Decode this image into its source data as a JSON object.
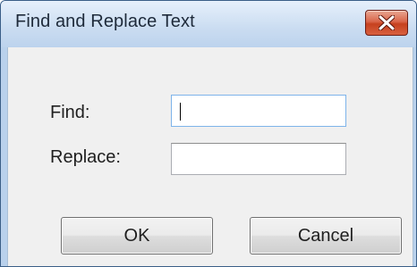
{
  "window": {
    "title": "Find and Replace Text"
  },
  "title_bar": {
    "close_icon": "close-x-icon"
  },
  "form": {
    "find_label": "Find:",
    "find_value": "",
    "replace_label": "Replace:",
    "replace_value": ""
  },
  "buttons": {
    "ok_label": "OK",
    "cancel_label": "Cancel"
  },
  "colors": {
    "close_button": "#d4583a",
    "titlebar": "#c9dcf1",
    "client_background": "#f0f0f0",
    "focused_field_border": "#7eb4ea"
  }
}
